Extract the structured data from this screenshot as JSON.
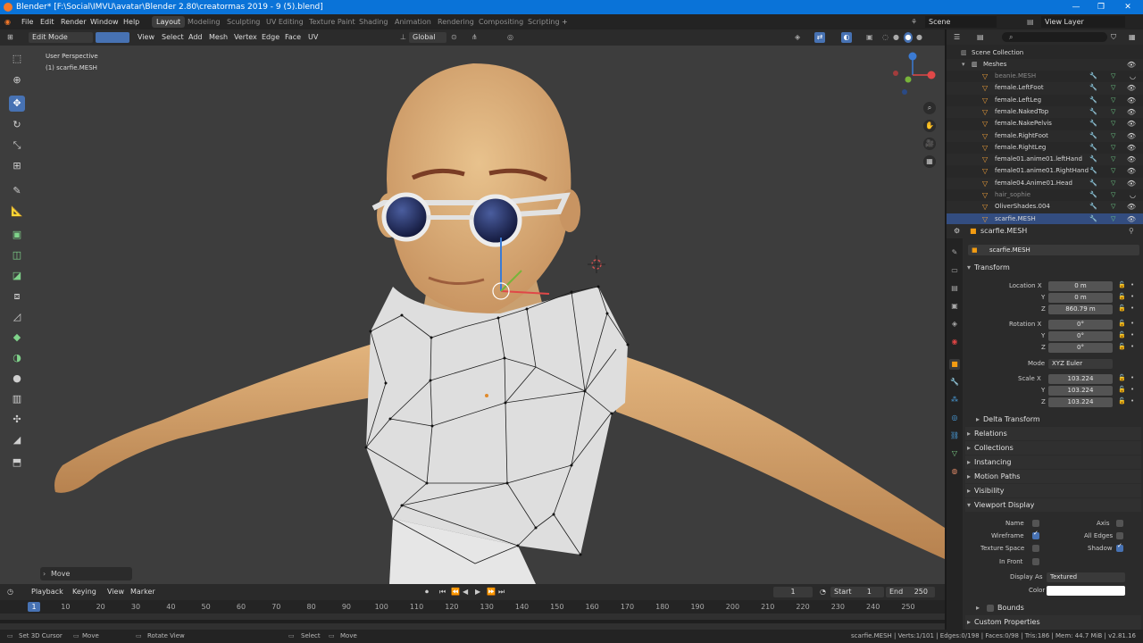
{
  "window": {
    "title": "Blender* [F:\\Social\\IMVU\\avatar\\Blender 2.80\\creatormas 2019 - 9 (5).blend]",
    "minimize_icon": "minimize-icon",
    "maximize_icon": "maximize-icon",
    "close_icon": "close-icon"
  },
  "menu": {
    "items": [
      "File",
      "Edit",
      "Render",
      "Window",
      "Help"
    ]
  },
  "workspaces": [
    "Layout",
    "Modeling",
    "Sculpting",
    "UV Editing",
    "Texture Paint",
    "Shading",
    "Animation",
    "Rendering",
    "Compositing",
    "Scripting"
  ],
  "workspace_add": "+",
  "scene": {
    "scene_label": "Scene",
    "view_layer_label": "View Layer"
  },
  "viewport_header": {
    "mode": "Edit Mode",
    "menus": [
      "View",
      "Select",
      "Add",
      "Mesh",
      "Vertex",
      "Edge",
      "Face",
      "UV"
    ],
    "orientation": "Global"
  },
  "viewport": {
    "perspective": "User Perspective",
    "object": "(1) scarfie.MESH"
  },
  "operator_panel": {
    "label": "Move"
  },
  "timeline": {
    "menus": [
      "Playback",
      "Keying",
      "View",
      "Marker"
    ],
    "current_frame": "1",
    "start_label": "Start",
    "start": "1",
    "end_label": "End",
    "end": "250",
    "ruler": [
      "10",
      "20",
      "30",
      "40",
      "50",
      "60",
      "70",
      "80",
      "90",
      "100",
      "110",
      "120",
      "130",
      "140",
      "150",
      "160",
      "170",
      "180",
      "190",
      "200",
      "210",
      "220",
      "230",
      "240",
      "250"
    ],
    "playhead": "1"
  },
  "status": {
    "items": [
      "Set 3D Cursor",
      "Move",
      "Rotate View",
      "Select",
      "Move"
    ],
    "stats": "scarfie.MESH | Verts:1/101 | Edges:0/198 | Faces:0/98 | Tris:186 | Mem: 44.7 MiB | v2.81.16"
  },
  "outliner": {
    "collection": "Scene Collection",
    "meshes": "Meshes",
    "items": [
      {
        "name": "beanie.MESH",
        "dim": true
      },
      {
        "name": "female.LeftFoot",
        "dim": false
      },
      {
        "name": "female.LeftLeg",
        "dim": false
      },
      {
        "name": "female.NakedTop",
        "dim": false
      },
      {
        "name": "female.NakePelvis",
        "dim": false
      },
      {
        "name": "female.RightFoot",
        "dim": false
      },
      {
        "name": "female.RightLeg",
        "dim": false
      },
      {
        "name": "female01.anime01.leftHand",
        "dim": false
      },
      {
        "name": "female01.anime01.RightHand",
        "dim": false
      },
      {
        "name": "female04.Anime01.Head",
        "dim": false
      },
      {
        "name": "hair_sophie",
        "dim": true
      },
      {
        "name": "OliverShades.004",
        "dim": false
      },
      {
        "name": "scarfie.MESH",
        "dim": false,
        "selected": true
      }
    ]
  },
  "properties": {
    "object_name": "scarfie.MESH",
    "data_name": "scarfie.MESH",
    "transform_label": "Transform",
    "location_label": "Location X",
    "rotation_label": "Rotation X",
    "scale_label": "Scale X",
    "axis_y": "Y",
    "axis_z": "Z",
    "location": [
      "0 m",
      "0 m",
      "860.79 m"
    ],
    "rotation": [
      "0°",
      "0°",
      "0°"
    ],
    "mode_label": "Mode",
    "mode": "XYZ Euler",
    "scale": [
      "103.224",
      "103.224",
      "103.224"
    ],
    "delta": "Delta Transform",
    "sections": [
      "Relations",
      "Collections",
      "Instancing",
      "Motion Paths",
      "Visibility"
    ],
    "viewport_display": "Viewport Display",
    "vd": {
      "name": "Name",
      "axis": "Axis",
      "wireframe": "Wireframe",
      "all_edges": "All Edges",
      "texture_space": "Texture Space",
      "shadow": "Shadow",
      "in_front": "In Front",
      "display_as_label": "Display As",
      "display_as": "Textured",
      "color_label": "Color"
    },
    "bounds": "Bounds",
    "custom": "Custom Properties"
  },
  "colors": {
    "accent": "#4772b3",
    "titlebar": "#0a73d8",
    "viewport": "#3d3d3d",
    "active_tab": "#f39c12"
  }
}
